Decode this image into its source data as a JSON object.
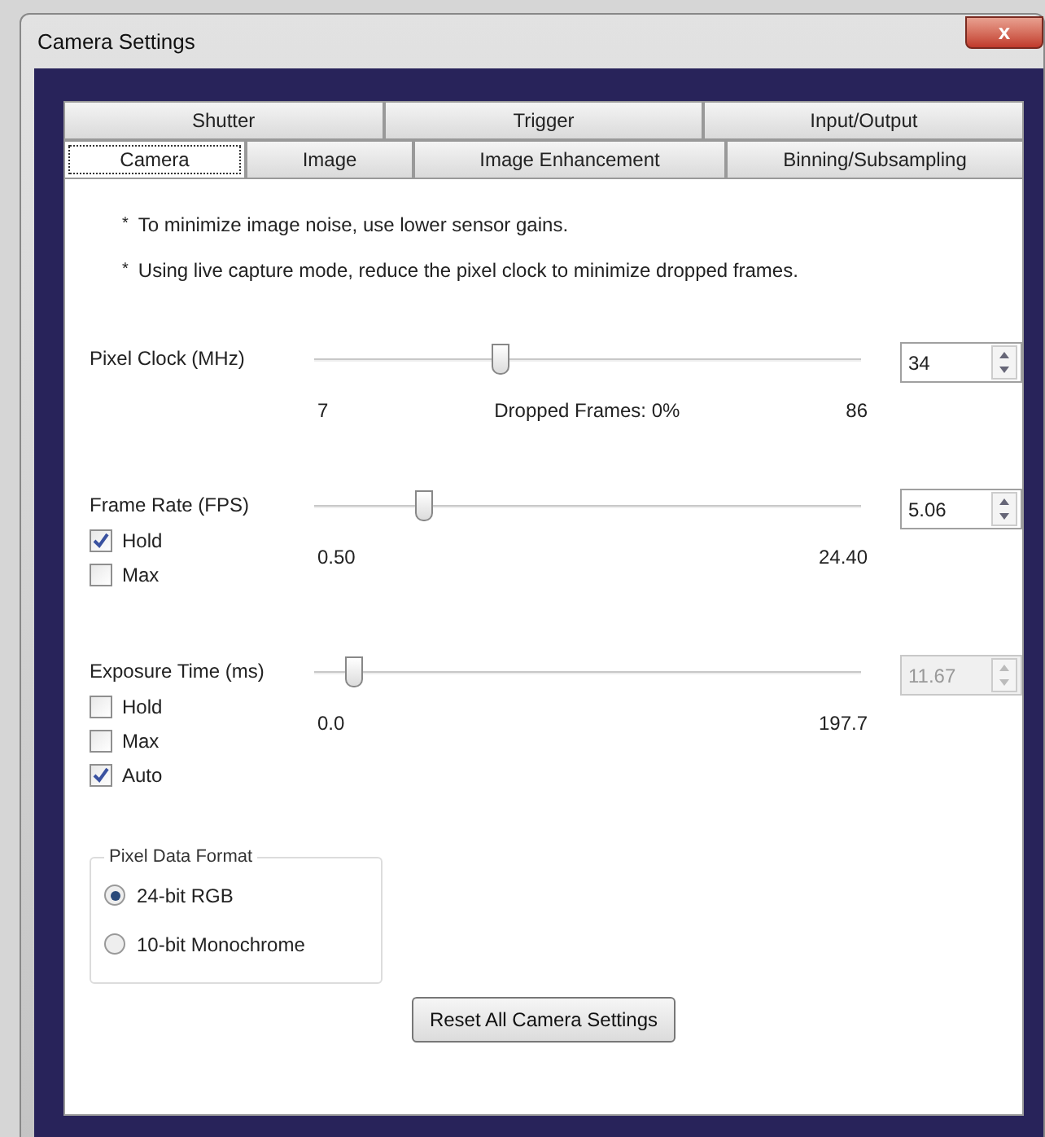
{
  "window": {
    "title": "Camera Settings",
    "close": "x"
  },
  "tabs": [
    [
      {
        "label": "Shutter",
        "selected": false
      },
      {
        "label": "Trigger",
        "selected": false
      },
      {
        "label": "Input/Output",
        "selected": false
      }
    ],
    [
      {
        "label": "Camera",
        "selected": true
      },
      {
        "label": "Image",
        "selected": false
      },
      {
        "label": "Image Enhancement",
        "selected": false
      },
      {
        "label": "Binning/Subsampling",
        "selected": false
      }
    ]
  ],
  "notes": [
    {
      "bullet": "*",
      "text": "To minimize image noise, use lower sensor gains."
    },
    {
      "bullet": "*",
      "text": "Using live capture mode, reduce the pixel clock to minimize dropped frames."
    }
  ],
  "controls": [
    {
      "label": "Pixel Clock (MHz)",
      "level": 0.34,
      "value": "34",
      "disabled": false,
      "min": "7",
      "max": "86",
      "middle": "Dropped Frames: 0%"
    },
    {
      "label": "Frame Rate (FPS)",
      "level": 0.2,
      "value": "5.06",
      "disabled": false,
      "min": "0.50",
      "max": "24.40",
      "checkboxes": [
        {
          "label": "Hold",
          "checked": true
        },
        {
          "label": "Max",
          "checked": false
        }
      ]
    },
    {
      "label": "Exposure Time (ms)",
      "level": 0.07,
      "value": "11.67",
      "disabled": true,
      "min": "0.0",
      "max": "197.7",
      "checkboxes": [
        {
          "label": "Hold",
          "checked": false
        },
        {
          "label": "Max",
          "checked": false
        },
        {
          "label": "Auto",
          "checked": true
        }
      ]
    }
  ],
  "pixel_data_format": {
    "title": "Pixel Data Format",
    "options": [
      {
        "label": "24-bit RGB",
        "selected": true
      },
      {
        "label": "10-bit Monochrome",
        "selected": false
      }
    ]
  },
  "reset_button": "Reset All Camera Settings"
}
